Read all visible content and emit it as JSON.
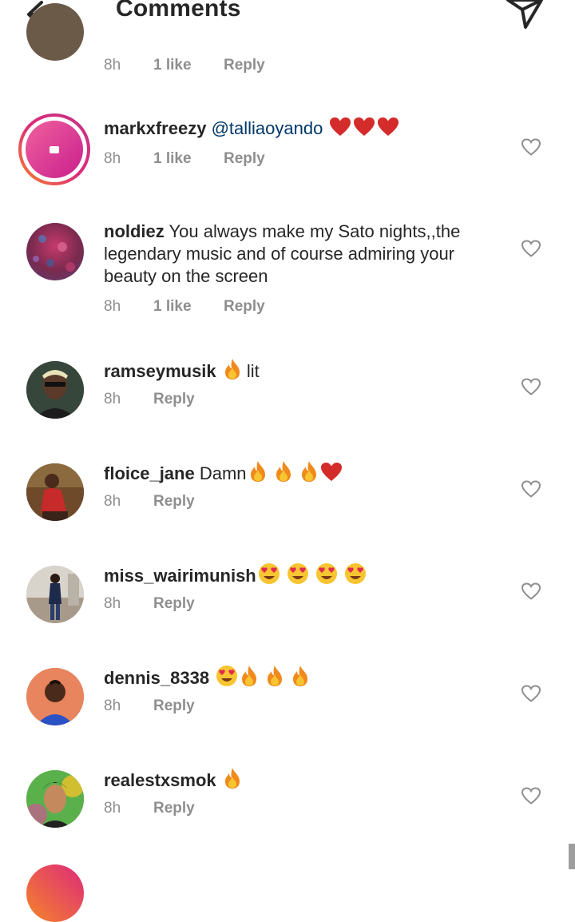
{
  "header": {
    "title": "Comments",
    "back_icon": "arrow-left-icon",
    "send_icon": "paper-plane-icon"
  },
  "colors": {
    "text": "#262626",
    "meta": "#8e8e8e",
    "mention": "#00376b",
    "story_ring_start": "#f58529",
    "story_ring_end": "#dd2a7b"
  },
  "top_partial": {
    "time": "8h",
    "likes": "1 like",
    "reply": "Reply"
  },
  "comments": [
    {
      "username": "markxfreezy",
      "mention": "@talliaoyando",
      "text": "",
      "emoji": [
        "heart",
        "heart",
        "heart"
      ],
      "time": "8h",
      "likes": "1 like",
      "reply": "Reply"
    },
    {
      "username": "noldiez",
      "text": "You always make my Sato nights,,the legendary music and of course admiring your beauty on the screen",
      "time": "8h",
      "likes": "1 like",
      "reply": "Reply"
    },
    {
      "username": "ramseymusik",
      "text": "lit",
      "emoji_before": [
        "fire"
      ],
      "time": "8h",
      "reply": "Reply"
    },
    {
      "username": "floice_jane",
      "text": "Damn",
      "emoji": [
        "fire",
        "fire",
        "fire",
        "heart"
      ],
      "time": "8h",
      "reply": "Reply"
    },
    {
      "username": "miss_wairimunish",
      "text": "",
      "emoji": [
        "heart-eyes",
        "heart-eyes",
        "heart-eyes",
        "heart-eyes"
      ],
      "time": "8h",
      "reply": "Reply"
    },
    {
      "username": "dennis_8338",
      "text": "",
      "emoji": [
        "heart-eyes",
        "fire",
        "fire",
        "fire"
      ],
      "time": "8h",
      "reply": "Reply"
    },
    {
      "username": "realestxsmok",
      "text": "",
      "emoji": [
        "fire"
      ],
      "time": "8h",
      "reply": "Reply"
    }
  ]
}
